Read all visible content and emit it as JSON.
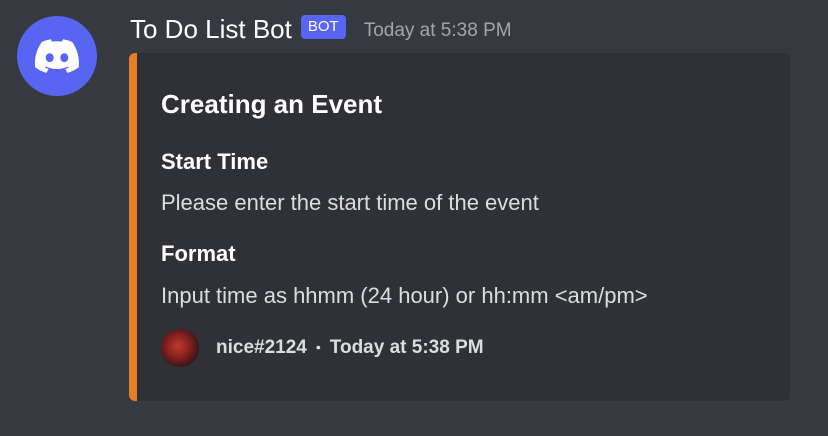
{
  "message": {
    "author": "To Do List Bot",
    "bot_tag": "BOT",
    "timestamp": "Today at 5:38 PM"
  },
  "embed": {
    "accent_color": "#e67e22",
    "title": "Creating an Event",
    "fields": [
      {
        "name": "Start Time",
        "value": "Please enter the start time of the event"
      },
      {
        "name": "Format",
        "value": "Input time as hhmm (24 hour) or hh:mm <am/pm>"
      }
    ],
    "footer": {
      "user": "nice#2124",
      "separator": "•",
      "timestamp": "Today at 5:38 PM"
    }
  }
}
